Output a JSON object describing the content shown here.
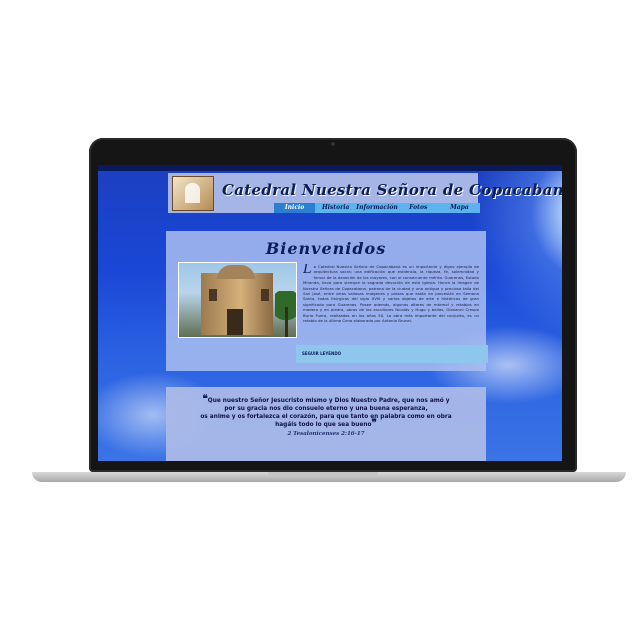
{
  "site": {
    "title": "Catedral Nuestra Señora de Copacabana"
  },
  "nav": {
    "items": [
      "Inicio",
      "Historia",
      "Información",
      "Fotos",
      "Mapa"
    ],
    "active": "Inicio"
  },
  "main": {
    "heading": "Bienvenidos",
    "dropcap": "L",
    "body": "a Catedral Nuestra Señora de Copacabana es un importante y digno ejemplo de arquitectura sacra; una edificación que evidencia, la riqueza, fe, solemnidad y fervor de la devoción de los mayores, con el consecuente mérito. Guarenas, Estado Miranda, lleva para siempre la sagrada devoción de esta iglesia. Honra la imagen de Nuestra Señora de Copacabana, patrona de la ciudad y una antigua y preciosa talla del San José, entre otras valiosas imágenes y piezas que están en procesión en Semana Santa, todas litúrgicas del siglo XVIII y varios objetos de arte e históricos de gran significado para Guarenas. Posee además, algunos altares de mármol y retablos en madera y en piedra, obras de los escultores Nicolás y Hugo y bellas, Giovanni Crespo Burla Fuera, realizadas en los años 50. La obra más importante del conjunto, es un retablo de la última Cena elaborado por Antonio Brunei.",
    "read_more": "SEGUIR LEYENDO"
  },
  "quote": {
    "open_mark": "❝",
    "close_mark": "❞",
    "line1": "Que nuestro Señor Jesucristo mismo y Dios Nuestro Padre, que nos amó y",
    "line2": "por su gracia nos dio consuelo eterno y una buena esperanza,",
    "line3": "os anime y os fortalezca el corazón, para que tanto en palabra como en obra",
    "line4": "hagáis todo lo que sea bueno",
    "reference": "2 Tesalonicenses 2:16-17"
  },
  "icons": {
    "logo": "church-logo-icon",
    "photo": "cathedral-photo"
  },
  "colors": {
    "background_sky": "#1a47d6",
    "header_band": "#a5b6e6",
    "nav_bar": "#5db3ee",
    "title_text": "#0b1d5a"
  }
}
